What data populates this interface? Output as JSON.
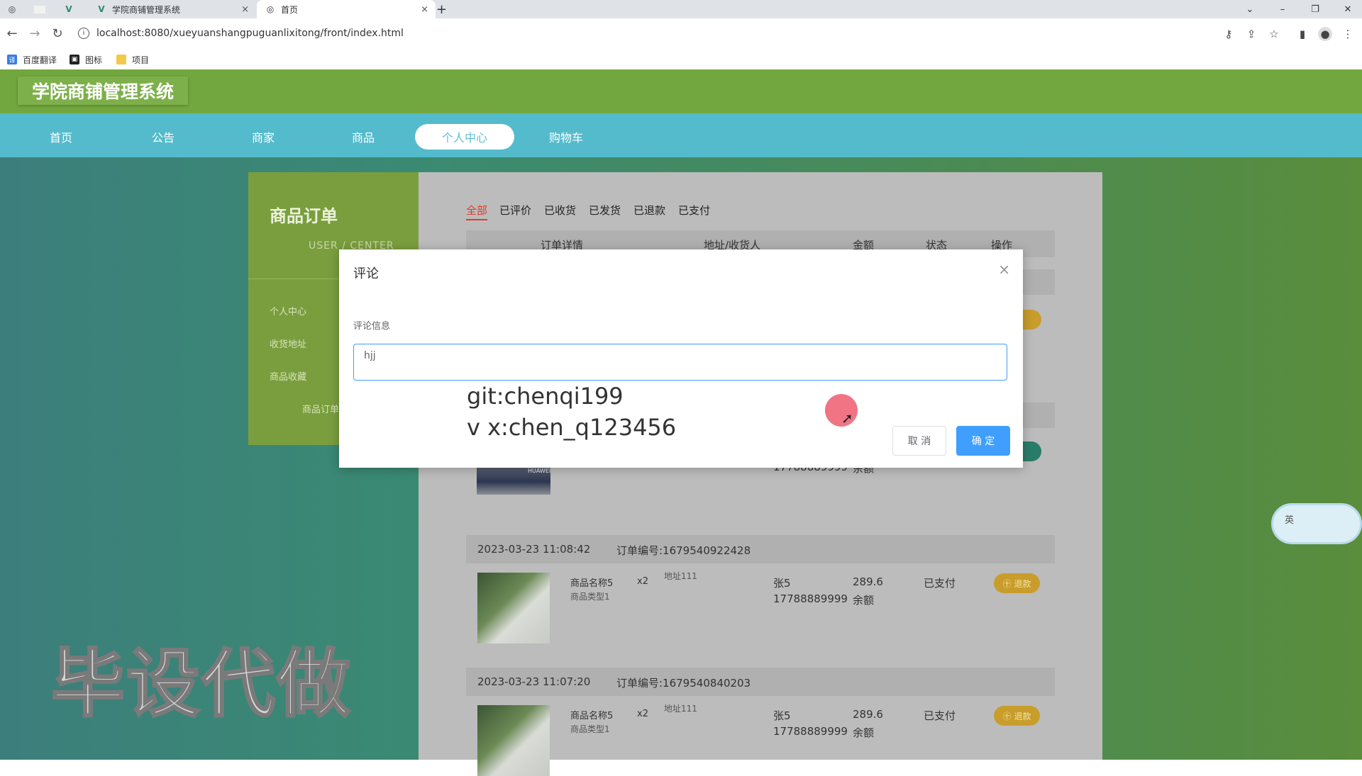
{
  "browser": {
    "tabs": [
      {
        "label": "学院商铺管理系统",
        "active": false
      },
      {
        "label": "首页",
        "active": true
      }
    ],
    "close_icon": "×",
    "new_tab_icon": "+",
    "url": "localhost:8080/xueyuanshangpuguanlixitong/front/index.html",
    "bookmarks": [
      "百度翻译",
      "图标",
      "项目"
    ]
  },
  "site": {
    "title": "学院商铺管理系统",
    "nav": [
      "首页",
      "公告",
      "商家",
      "商品",
      "个人中心",
      "购物车"
    ],
    "active_nav": "个人中心"
  },
  "sidebar": {
    "title": "商品订单",
    "subtitle": "USER / CENTER",
    "items": [
      "个人中心",
      "收货地址",
      "商品收藏",
      "商品订单"
    ]
  },
  "orders": {
    "tabs": [
      "全部",
      "已评价",
      "已收货",
      "已发货",
      "已退款",
      "已支付"
    ],
    "active_tab": "全部",
    "columns": [
      "订单详情",
      "地址/收货人",
      "金额",
      "状态",
      "操作"
    ],
    "partial_row": {
      "phone": "17788889999",
      "pay": "余额",
      "brand": "HUAWEI"
    },
    "list": [
      {
        "time": "2023-03-23 11:08:42",
        "order_no": "订单编号:1679540922428",
        "product": "商品名称5",
        "type": "商品类型1",
        "qty": "x2",
        "address": "地址111",
        "receiver": "张5",
        "phone": "17788889999",
        "amount": "289.6",
        "pay": "余额",
        "status": "已支付",
        "action": "退款"
      },
      {
        "time": "2023-03-23 11:07:20",
        "order_no": "订单编号:1679540840203",
        "product": "商品名称5",
        "type": "商品类型1",
        "qty": "x2",
        "address": "地址111",
        "receiver": "张5",
        "phone": "17788889999",
        "amount": "289.6",
        "pay": "余额",
        "status": "已支付",
        "action": "退款"
      }
    ]
  },
  "modal": {
    "title": "评论",
    "close_icon": "×",
    "label": "评论信息",
    "textarea_value": "hjj",
    "cancel": "取 消",
    "ok": "确 定"
  },
  "overlay": {
    "line1": "git:chenqi199",
    "line2": "v x:chen_q123456",
    "big_watermark": "毕设代做",
    "ime_label": "英"
  }
}
